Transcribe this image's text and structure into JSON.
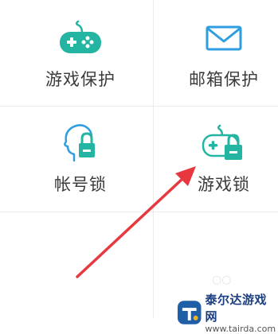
{
  "tiles": [
    {
      "label": "游戏保护",
      "icon": "gamepad-icon"
    },
    {
      "label": "邮箱保护",
      "icon": "mail-icon"
    },
    {
      "label": "帐号锁",
      "icon": "account-lock-icon"
    },
    {
      "label": "游戏锁",
      "icon": "game-lock-icon"
    }
  ],
  "watermark": {
    "text": "泰尔达游戏网",
    "url": "www.tairda.com",
    "icon": "tairda-logo-icon"
  },
  "colors": {
    "accent": "#24b5a2",
    "annotation_arrow": "#e8383f",
    "divider": "#ececec"
  }
}
